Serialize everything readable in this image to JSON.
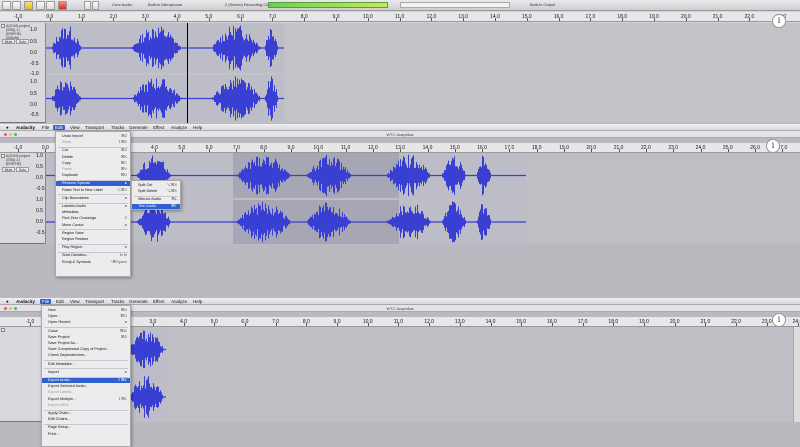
{
  "toolbar": {
    "mic_device": "Built-in Microphone",
    "channels": "2 (Stereo) Recording Ch...",
    "output_device": "Built-in Output",
    "audio_host": "Core Audio",
    "speaker_device": "Built-in Output",
    "meter_scale": [
      "-54",
      "-48",
      "-42",
      "-36",
      "-30",
      "-24",
      "-18",
      "-12",
      "-6",
      "0"
    ]
  },
  "ruler_ticks": [
    "-1.0",
    "0.0",
    "1.0",
    "2.0",
    "3.0",
    "4.0",
    "5.0",
    "6.0",
    "7.0",
    "8.0",
    "9.0",
    "10.0",
    "11.0",
    "12.0",
    "13.0",
    "14.0",
    "15.0",
    "16.0",
    "17.0",
    "18.0",
    "19.0",
    "20.0",
    "21.0",
    "22.0",
    "23.0",
    "24.0"
  ],
  "ruler_ticks_p2": [
    "-1.0",
    "0.0",
    "1.0",
    "2.0",
    "3.0",
    "4.0",
    "5.0",
    "6.0",
    "7.0",
    "8.0",
    "9.0",
    "10.0",
    "11.0",
    "12.0",
    "13.0",
    "14.0",
    "15.0",
    "16.0",
    "17.0",
    "18.0",
    "19.0",
    "20.0",
    "21.0",
    "22.0",
    "23.0",
    "24.0",
    "25.0",
    "26.0",
    "27.0"
  ],
  "track": {
    "name_lines": [
      "&(2019) project",
      "(005)(-1)(ERIFHE)",
      "(005)dfe"
    ],
    "mute": "Mute",
    "solo": "Solo",
    "scale": [
      "1.0",
      "0.5",
      "0.0",
      "-0.5",
      "-1.0"
    ]
  },
  "menubar": {
    "apple": "",
    "app": "Audacity",
    "items": [
      "File",
      "Edit",
      "View",
      "Transport",
      "Tracks",
      "Generate",
      "Effect",
      "Analyze",
      "Help"
    ]
  },
  "window_title": "WTC Acapellas",
  "edit_menu": [
    {
      "label": "Undo Import",
      "sc": "⌘Z",
      "dis": false
    },
    {
      "label": "Redo",
      "sc": "⇧⌘Z",
      "dis": true
    },
    {
      "label": "Cut",
      "sc": "⌘X",
      "dis": false,
      "gap": true
    },
    {
      "label": "Delete",
      "sc": "⌘K",
      "dis": false
    },
    {
      "label": "Copy",
      "sc": "⌘C",
      "dis": false
    },
    {
      "label": "Paste",
      "sc": "⌘V",
      "dis": true
    },
    {
      "label": "Duplicate",
      "sc": "⌘D",
      "dis": false
    },
    {
      "label": "Remove Special",
      "sc": "▸",
      "dis": false,
      "hl": true,
      "gap": true
    },
    {
      "label": "Paste Text to New Label",
      "sc": "⌥⌘V",
      "dis": false
    },
    {
      "label": "Clip Boundaries",
      "sc": "▸",
      "dis": false,
      "gap": true
    },
    {
      "label": "Labeled Audio",
      "sc": "▸",
      "dis": false,
      "gap": true
    },
    {
      "label": "Metadata...",
      "sc": "",
      "dis": false
    },
    {
      "label": "Find Zero Crossings",
      "sc": "Z",
      "dis": false
    },
    {
      "label": "Move Cursor",
      "sc": "▸",
      "dis": false
    },
    {
      "label": "Region Save",
      "sc": "",
      "dis": false,
      "gap": true
    },
    {
      "label": "Region Restore",
      "sc": "",
      "dis": false
    },
    {
      "label": "Play Region",
      "sc": "▸",
      "dis": false,
      "gap": true
    },
    {
      "label": "Start Dictation...",
      "sc": "fn fn",
      "dis": false,
      "gap": true
    },
    {
      "label": "Emoji & Symbols",
      "sc": "^⌘Space",
      "dis": false
    }
  ],
  "remove_special_menu": [
    {
      "label": "Split Cut",
      "sc": "⌥⌘X"
    },
    {
      "label": "Split Delete",
      "sc": "⌥⌘K"
    },
    {
      "label": "Silence Audio",
      "sc": "⌘L",
      "gap": true
    },
    {
      "label": "Trim Audio",
      "sc": "⌘T",
      "hl": true
    }
  ],
  "file_menu": [
    {
      "label": "New",
      "sc": "⌘N"
    },
    {
      "label": "Open...",
      "sc": "⌘O"
    },
    {
      "label": "Open Recent",
      "sc": "▸"
    },
    {
      "label": "Close",
      "sc": "⌘W",
      "gap": true
    },
    {
      "label": "Save Project",
      "sc": "⌘S"
    },
    {
      "label": "Save Project As...",
      "sc": ""
    },
    {
      "label": "Save Compressed Copy of Project...",
      "sc": ""
    },
    {
      "label": "Check Dependencies...",
      "sc": ""
    },
    {
      "label": "Edit Metadata...",
      "sc": "",
      "gap": true
    },
    {
      "label": "Import",
      "sc": "▸",
      "gap": true
    },
    {
      "label": "Export Audio...",
      "sc": "⇧⌘E",
      "hl": true,
      "gap": true
    },
    {
      "label": "Export Selected Audio...",
      "sc": ""
    },
    {
      "label": "Export Labels...",
      "sc": "",
      "dis": true
    },
    {
      "label": "Export Multiple...",
      "sc": "⇧⌘L"
    },
    {
      "label": "Export MIDI...",
      "sc": "",
      "dis": true
    },
    {
      "label": "Apply Chain...",
      "sc": "",
      "gap": true
    },
    {
      "label": "Edit Chains...",
      "sc": ""
    },
    {
      "label": "Page Setup...",
      "sc": "",
      "gap": true
    },
    {
      "label": "Print...",
      "sc": ""
    }
  ],
  "colors": {
    "wave": "#3a3fd4",
    "selection": "#a6a6b5",
    "accent": "#2f5fd0"
  }
}
